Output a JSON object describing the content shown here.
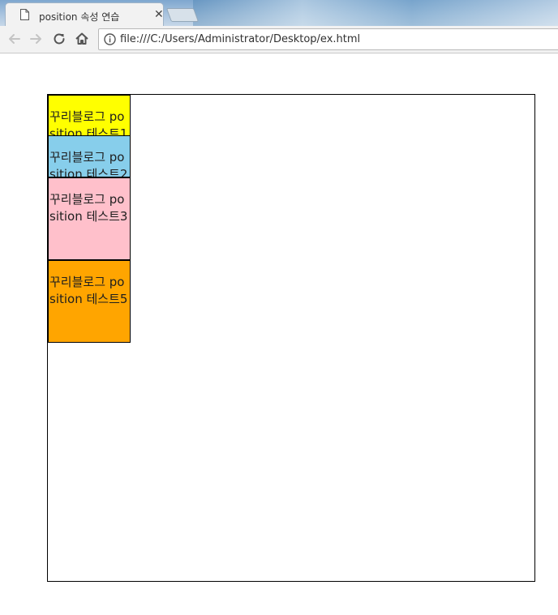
{
  "browser": {
    "tab": {
      "title": "position 속성 연습",
      "close_glyph": "✕",
      "icon": "page-icon"
    },
    "toolbar": {
      "back_icon": "arrow-left-icon",
      "forward_icon": "arrow-right-icon",
      "reload_icon": "reload-icon",
      "home_icon": "home-icon"
    },
    "address_bar": {
      "info_icon": "info-icon",
      "url": "file:///C:/Users/Administrator/Desktop/ex.html"
    }
  },
  "page": {
    "boxes": [
      {
        "text": "꾸리블로그 position 테스트1",
        "color": "#ffff00"
      },
      {
        "text": "꾸리블로그 position 테스트2",
        "color": "#87ceeb"
      },
      {
        "text": "꾸리블로그 position 테스트3",
        "color": "#ffc0cb"
      },
      {
        "text": "꾸리블로그 position 테스트5",
        "color": "#ffa500"
      }
    ]
  }
}
